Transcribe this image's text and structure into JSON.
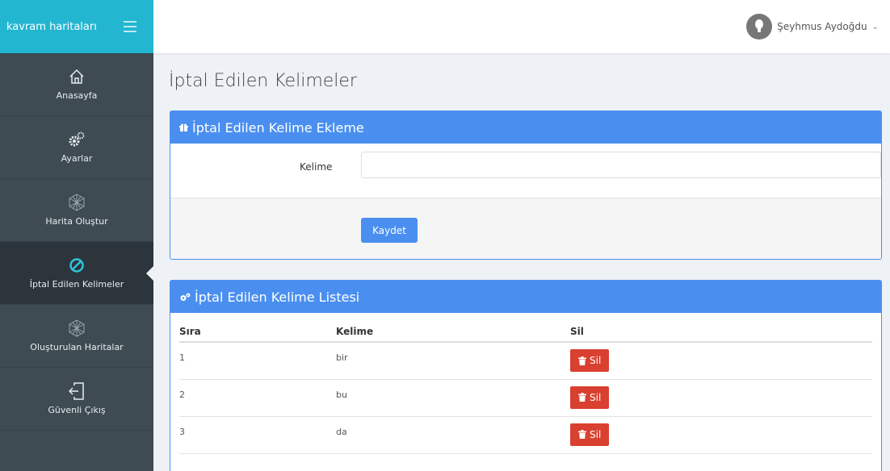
{
  "header": {
    "brand": "kavram haritaları",
    "user_name": "Şeyhmus Aydoğdu",
    "caret": "⌄"
  },
  "sidebar": {
    "items": [
      {
        "label": "Anasayfa",
        "icon": "home-icon"
      },
      {
        "label": "Ayarlar",
        "icon": "gears-icon"
      },
      {
        "label": "Harita Oluştur",
        "icon": "network-icon"
      },
      {
        "label": "İptal Edilen Kelimeler",
        "icon": "ban-icon",
        "active": true
      },
      {
        "label": "Oluşturulan Haritalar",
        "icon": "network-icon"
      },
      {
        "label": "Güvenli Çıkış",
        "icon": "logout-icon"
      }
    ]
  },
  "page": {
    "title": "İptal Edilen Kelimeler"
  },
  "add_panel": {
    "title": "İptal Edilen Kelime Ekleme",
    "field_label": "Kelime",
    "field_value": "",
    "save_label": "Kaydet"
  },
  "list_panel": {
    "title": "İptal Edilen Kelime Listesi",
    "columns": [
      "Sıra",
      "Kelime",
      "Sil"
    ],
    "rows": [
      {
        "sira": "1",
        "kelime": "bir",
        "action": "Sil"
      },
      {
        "sira": "2",
        "kelime": "bu",
        "action": "Sil"
      },
      {
        "sira": "3",
        "kelime": "da",
        "action": "Sil"
      }
    ]
  },
  "colors": {
    "brand": "#22b6d0",
    "sidebar": "#3e4b53",
    "primary": "#4a8ff0",
    "danger": "#d9402f"
  }
}
